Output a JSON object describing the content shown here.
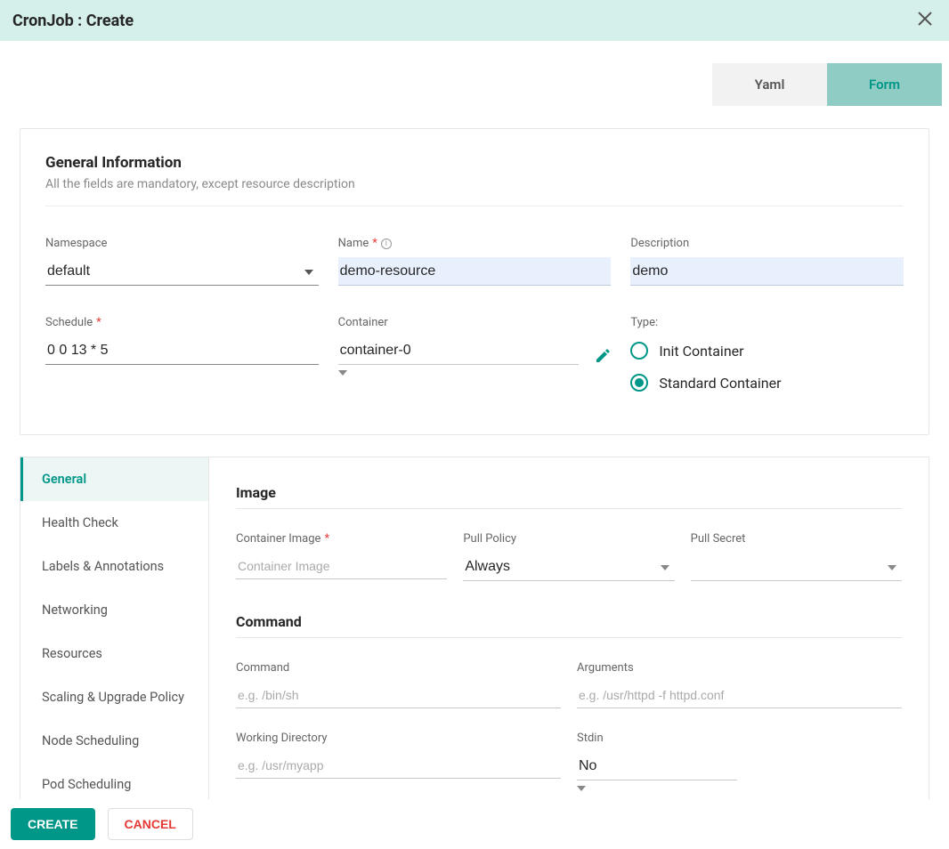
{
  "header": {
    "title": "CronJob : Create"
  },
  "toggle": {
    "yaml": "Yaml",
    "form": "Form"
  },
  "general": {
    "title": "General Information",
    "sub": "All the fields are mandatory, except resource description",
    "namespace_label": "Namespace",
    "namespace_value": "default",
    "name_label": "Name",
    "name_value": "demo-resource",
    "description_label": "Description",
    "description_value": "demo",
    "schedule_label": "Schedule",
    "schedule_value": "0 0 13 * 5",
    "container_label": "Container",
    "container_value": "container-0",
    "type_label": "Type:",
    "type_options": {
      "init": "Init Container",
      "standard": "Standard Container"
    },
    "type_selected": "standard"
  },
  "side_tabs": [
    "General",
    "Health Check",
    "Labels & Annotations",
    "Networking",
    "Resources",
    "Scaling & Upgrade Policy",
    "Node Scheduling",
    "Pod Scheduling"
  ],
  "image": {
    "title": "Image",
    "container_image_label": "Container Image",
    "container_image_placeholder": "Container Image",
    "pull_policy_label": "Pull Policy",
    "pull_policy_value": "Always",
    "pull_secret_label": "Pull Secret"
  },
  "command": {
    "title": "Command",
    "command_label": "Command",
    "command_placeholder": "e.g. /bin/sh",
    "args_label": "Arguments",
    "args_placeholder": "e.g. /usr/httpd -f httpd.conf",
    "wd_label": "Working Directory",
    "wd_placeholder": "e.g. /usr/myapp",
    "stdin_label": "Stdin",
    "stdin_value": "No"
  },
  "footer": {
    "create": "CREATE",
    "cancel": "CANCEL"
  }
}
